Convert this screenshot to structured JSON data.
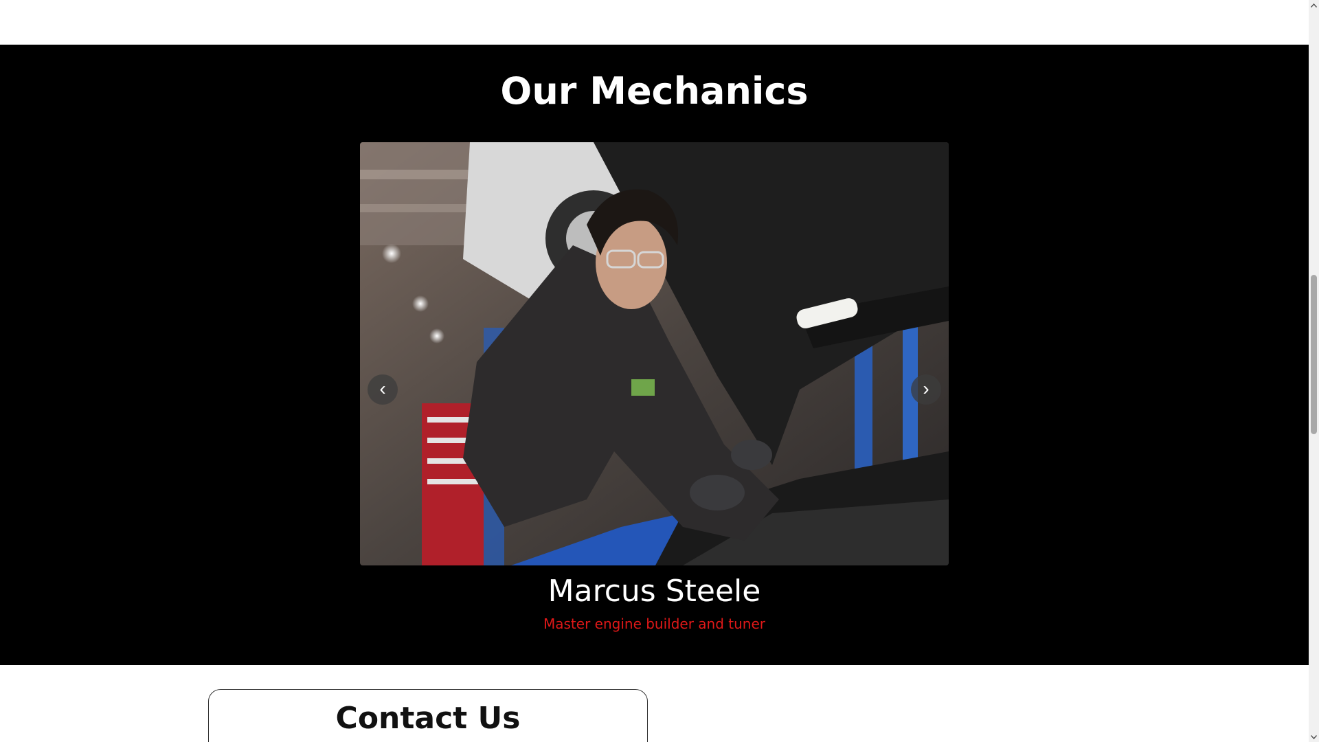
{
  "mechanics": {
    "title": "Our Mechanics",
    "current": {
      "name": "Marcus Steele",
      "role": "Master engine builder and tuner"
    },
    "prev_symbol": "‹",
    "next_symbol": "›"
  },
  "contact": {
    "title": "Contact Us"
  },
  "colors": {
    "section_bg": "#000000",
    "role_text": "#e01818",
    "page_bg": "#ffffff"
  }
}
